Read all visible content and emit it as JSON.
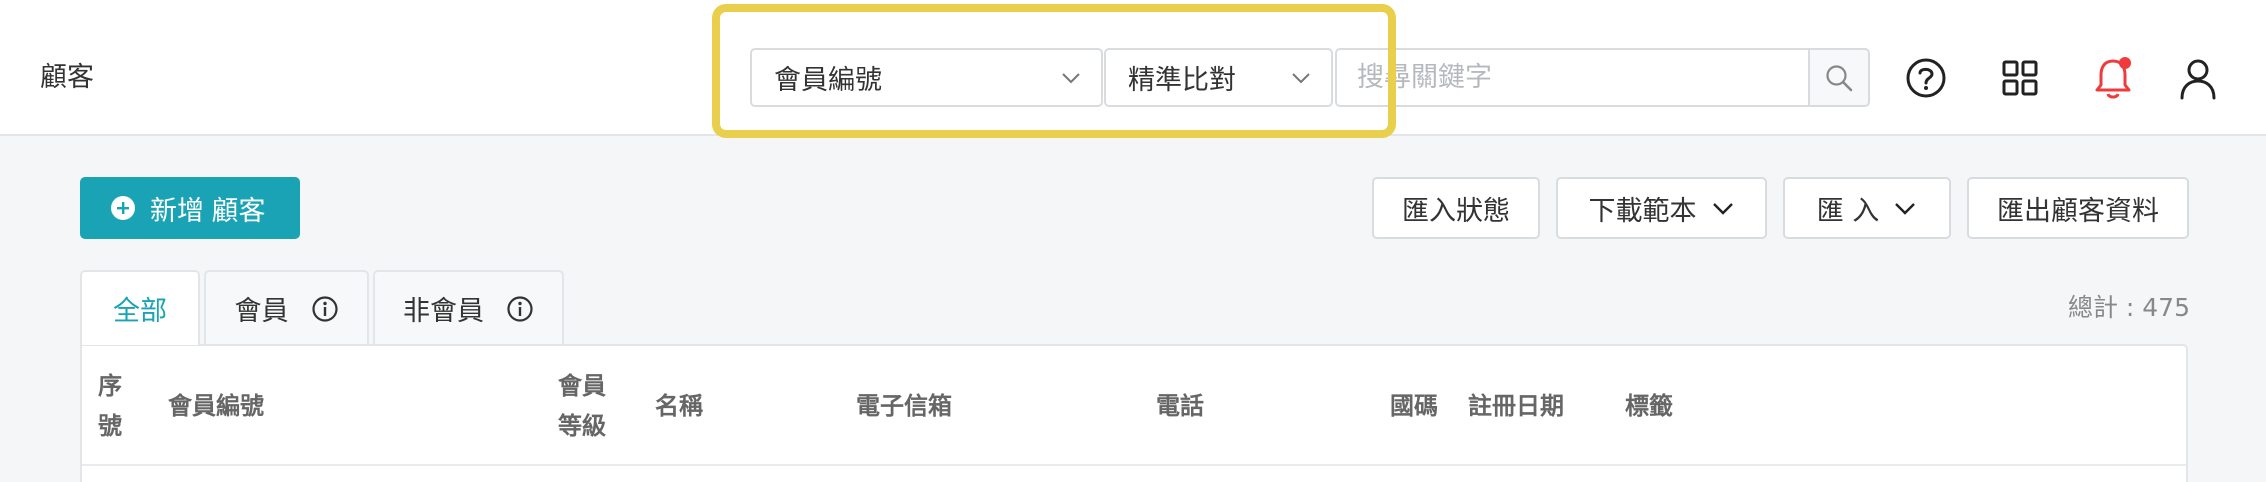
{
  "header": {
    "page_title": "顧客",
    "field_select": {
      "value": "會員編號"
    },
    "match_select": {
      "value": "精準比對"
    },
    "search": {
      "placeholder": "搜尋關鍵字"
    },
    "icons": [
      "help-icon",
      "apps-grid-icon",
      "notification-bell-icon",
      "user-icon"
    ]
  },
  "actions": {
    "add_customer": "新增 顧客",
    "import_status": "匯入狀態",
    "download_template": "下載範本",
    "import": "匯 入",
    "export": "匯出顧客資料"
  },
  "tabs": [
    {
      "label": "全部",
      "active": true
    },
    {
      "label": "會員",
      "info": true
    },
    {
      "label": "非會員",
      "info": true
    }
  ],
  "total_label": "總計 : 475",
  "table": {
    "columns": [
      {
        "line1": "序",
        "line2": "號"
      },
      {
        "line1": "會員編號"
      },
      {
        "line1": "會員",
        "line2": "等級"
      },
      {
        "line1": "名稱"
      },
      {
        "line1": "電子信箱"
      },
      {
        "line1": "電話"
      },
      {
        "line1": "國碼"
      },
      {
        "line1": "註冊日期"
      },
      {
        "line1": "標籤"
      }
    ]
  },
  "colors": {
    "accent": "#1aa3b5",
    "highlight": "#e9cf4c",
    "notification": "#ef3b3b"
  }
}
